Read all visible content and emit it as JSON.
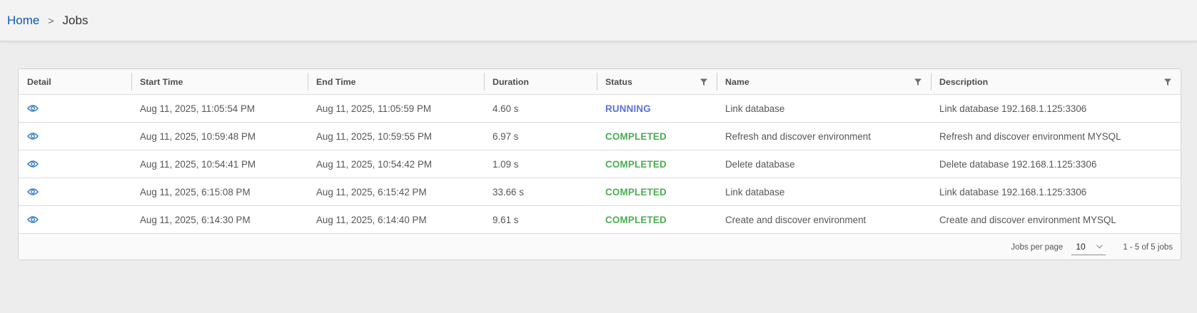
{
  "breadcrumb": {
    "home": "Home",
    "separator": ">",
    "current": "Jobs"
  },
  "table": {
    "columns": {
      "detail": "Detail",
      "start": "Start Time",
      "end": "End Time",
      "duration": "Duration",
      "status": "Status",
      "name": "Name",
      "description": "Description"
    },
    "rows": [
      {
        "start": "Aug 11, 2025, 11:05:54 PM",
        "end": "Aug 11, 2025, 11:05:59 PM",
        "duration": "4.60 s",
        "status": "RUNNING",
        "name": "Link database",
        "description": "Link database 192.168.1.125:3306"
      },
      {
        "start": "Aug 11, 2025, 10:59:48 PM",
        "end": "Aug 11, 2025, 10:59:55 PM",
        "duration": "6.97 s",
        "status": "COMPLETED",
        "name": "Refresh and discover environment",
        "description": "Refresh and discover environment MYSQL"
      },
      {
        "start": "Aug 11, 2025, 10:54:41 PM",
        "end": "Aug 11, 2025, 10:54:42 PM",
        "duration": "1.09 s",
        "status": "COMPLETED",
        "name": "Delete database",
        "description": "Delete database 192.168.1.125:3306"
      },
      {
        "start": "Aug 11, 2025, 6:15:08 PM",
        "end": "Aug 11, 2025, 6:15:42 PM",
        "duration": "33.66 s",
        "status": "COMPLETED",
        "name": "Link database",
        "description": "Link database 192.168.1.125:3306"
      },
      {
        "start": "Aug 11, 2025, 6:14:30 PM",
        "end": "Aug 11, 2025, 6:14:40 PM",
        "duration": "9.61 s",
        "status": "COMPLETED",
        "name": "Create and discover environment",
        "description": "Create and discover environment MYSQL"
      }
    ]
  },
  "footer": {
    "per_page_label": "Jobs per page",
    "per_page_value": "10",
    "range": "1 - 5 of 5 jobs"
  },
  "icons": {
    "detail": "eye-icon",
    "filter": "filter-icon",
    "select": "chevron-down-icon"
  },
  "colors": {
    "link": "#0b59b3",
    "running": "#5b72d6",
    "completed": "#4aad52",
    "eye": "#2f79c2"
  }
}
